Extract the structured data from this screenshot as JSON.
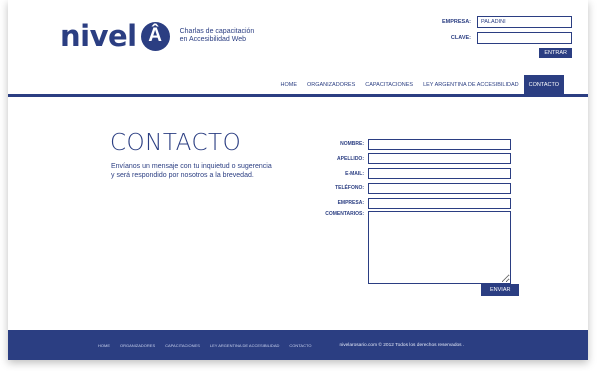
{
  "header": {
    "logo_word": "nivel",
    "logo_letter": "Â",
    "tagline_1": "Charlas de capacitación",
    "tagline_2": "en Accesibilidad Web"
  },
  "login": {
    "empresa_label": "EMPRESA:",
    "empresa_value": "PALADINI",
    "clave_label": "CLAVE:",
    "clave_value": "",
    "submit_label": "ENTRAR"
  },
  "nav": [
    {
      "label": "HOME",
      "active": false
    },
    {
      "label": "ORGANIZADORES",
      "active": false
    },
    {
      "label": "CAPACITACIONES",
      "active": false
    },
    {
      "label": "LEY ARGENTINA DE ACCESIBILIDAD",
      "active": false
    },
    {
      "label": "CONTACTO",
      "active": true
    }
  ],
  "contact": {
    "title": "CONTACTO",
    "description": "Envíanos un mensaje con tu inquietud o sugerencia y será respondido por nosotros a la brevedad."
  },
  "form": {
    "fields": [
      {
        "label": "NOMBRE:",
        "value": ""
      },
      {
        "label": "APELLIDO:",
        "value": ""
      },
      {
        "label": "E-MAIL:",
        "value": ""
      },
      {
        "label": "TELÉFONO:",
        "value": ""
      },
      {
        "label": "EMPRESA:",
        "value": ""
      }
    ],
    "comments_label": "COMENTARIOS:",
    "comments_value": "",
    "submit_label": "ENVIAR"
  },
  "footer": {
    "links": [
      "HOME",
      "ORGANIZADORES",
      "CAPACITACIONES",
      "LEY ARGENTINA DE ACCESIBILIDAD",
      "CONTACTO"
    ],
    "copyright": "nivelarosario.com © 2012 Todos los derechos reservados ."
  },
  "colors": {
    "brand": "#2b3e82",
    "background": "#ffffff"
  }
}
